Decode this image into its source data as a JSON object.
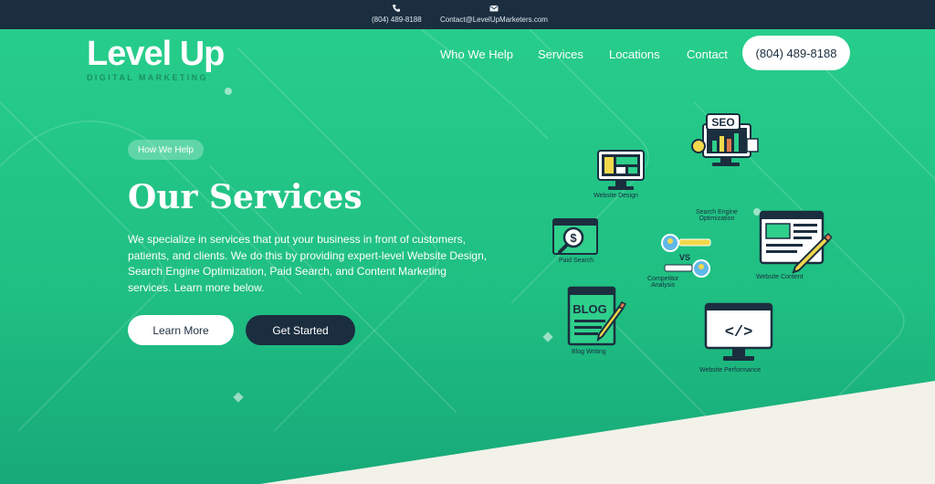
{
  "topbar": {
    "phone": "(804) 489-8188",
    "email": "Contact@LevelUpMarketers.com",
    "icons": [
      "phone-icon",
      "envelope-icon"
    ]
  },
  "logo": {
    "word": "Level Up",
    "sub": "DIGITAL MARKETING"
  },
  "nav": {
    "items": [
      "Who We Help",
      "Services",
      "Locations",
      "Contact"
    ],
    "phone_button": "(804) 489-8188"
  },
  "hero": {
    "pill": "How We Help",
    "title": "Our Services",
    "description": "We specialize in services that put your business in front of customers, patients, and clients. We do this by providing expert-level Website Design, Search Engine Optimization, Paid Search, and Content Marketing services. Learn more below.",
    "learn_more": "Learn More",
    "get_started": "Get Started"
  },
  "services": {
    "website_design": "Website Design",
    "seo_line1": "Search Engine",
    "seo_line2": "Optimization",
    "seo_badge": "SEO",
    "paid_search": "Paid Search",
    "competitor_line1": "Competitor",
    "competitor_line2": "Analysis",
    "vs": "VS",
    "website_content": "Website Content",
    "blog_writing": "Blog Writing",
    "blog_badge": "BLOG",
    "website_performance": "Website Performance",
    "code_badge": "</>"
  },
  "colors": {
    "accent_green": "#20c583",
    "navy": "#1b2e3f",
    "cream": "#f2f2e8",
    "white": "#ffffff"
  }
}
